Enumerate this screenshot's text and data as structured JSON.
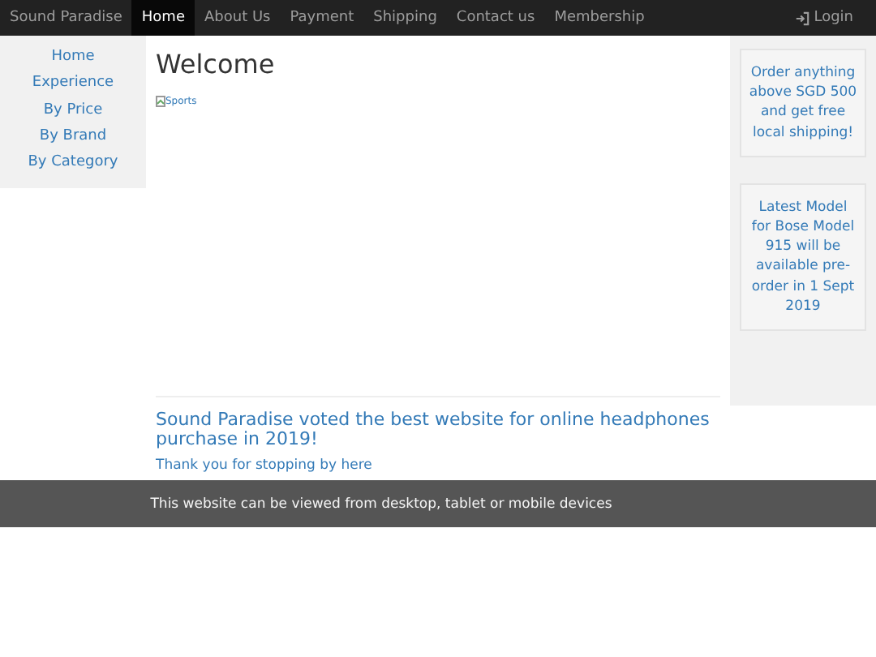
{
  "navbar": {
    "brand": "Sound Paradise",
    "items": [
      {
        "label": "Home",
        "selected": true
      },
      {
        "label": "About Us",
        "selected": false
      },
      {
        "label": "Payment",
        "selected": false
      },
      {
        "label": "Shipping",
        "selected": false
      },
      {
        "label": "Contact us",
        "selected": false
      },
      {
        "label": "Membership",
        "selected": false
      }
    ],
    "login": "Login"
  },
  "sidebar": {
    "items": [
      "Home",
      "Experience",
      "By Price",
      "By Brand",
      "By Category"
    ]
  },
  "main": {
    "title": "Welcome",
    "image_alt": "Sports",
    "headline": "Sound Paradise voted the best website for online headphones purchase in 2019!",
    "note": "Thank you for stopping by here"
  },
  "aside": {
    "cards": [
      "Order anything above SGD 500 and get free local shipping!",
      "Latest Model for Bose Model 915 will be available pre-order in 1 Sept 2019"
    ]
  },
  "footer": "This website can be viewed from desktop, tablet or mobile devices"
}
